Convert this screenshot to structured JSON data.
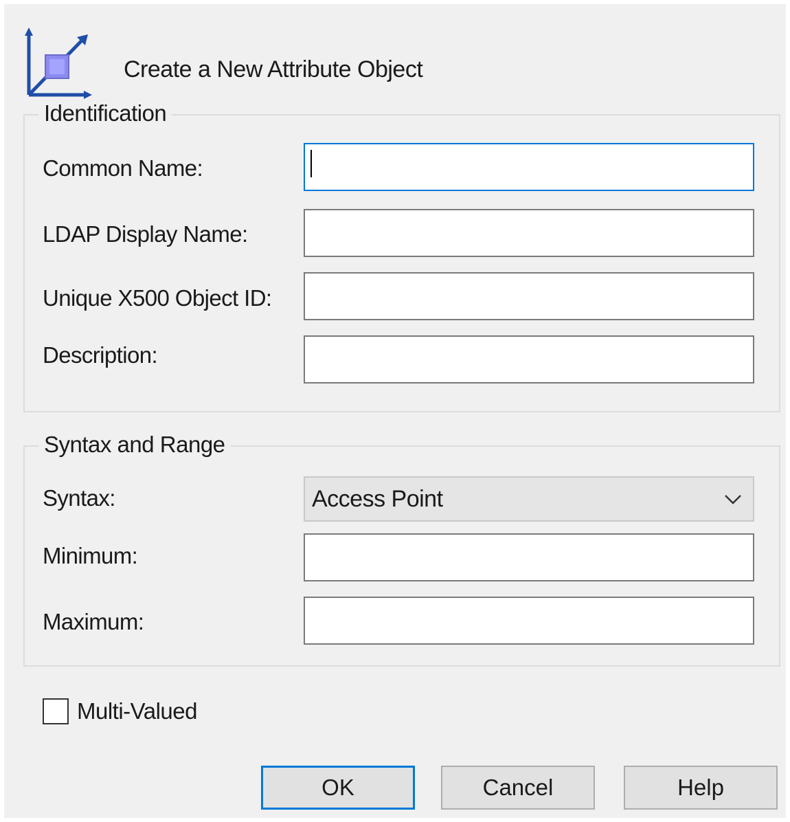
{
  "header": {
    "title": "Create a New Attribute Object",
    "icon": "attribute-object-icon"
  },
  "identification": {
    "legend": "Identification",
    "common_name_label": "Common Name:",
    "common_name_value": "",
    "ldap_display_name_label": "LDAP Display Name:",
    "ldap_display_name_value": "",
    "x500_oid_label": "Unique X500 Object ID:",
    "x500_oid_value": "",
    "description_label": "Description:",
    "description_value": ""
  },
  "syntax_range": {
    "legend": "Syntax and Range",
    "syntax_label": "Syntax:",
    "syntax_value": "Access Point",
    "minimum_label": "Minimum:",
    "minimum_value": "",
    "maximum_label": "Maximum:",
    "maximum_value": ""
  },
  "multi_valued": {
    "label": "Multi-Valued",
    "checked": false
  },
  "buttons": {
    "ok": "OK",
    "cancel": "Cancel",
    "help": "Help"
  },
  "colors": {
    "focus_border": "#0078d7",
    "icon_blue": "#1f4ea8",
    "icon_square": "#8b8bf0"
  }
}
